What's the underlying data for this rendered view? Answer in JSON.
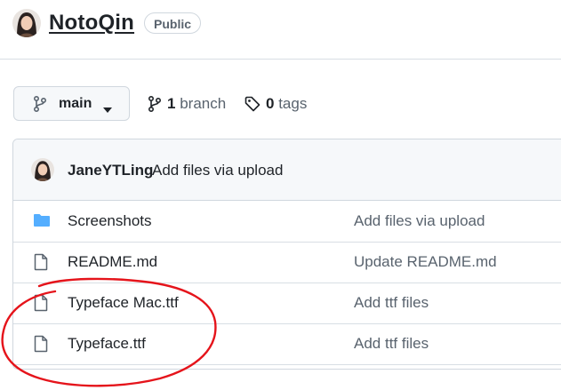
{
  "repo": {
    "owner_avatar": "user-avatar",
    "name": "NotoQin",
    "visibility": "Public"
  },
  "toolbar": {
    "branch_label": "main",
    "branch_count": "1",
    "branch_word": "branch",
    "tag_count": "0",
    "tag_word": "tags"
  },
  "latest_commit": {
    "author": "JaneYTLing",
    "message": "Add files via upload"
  },
  "files": [
    {
      "type": "folder",
      "name": "Screenshots",
      "commit": "Add files via upload"
    },
    {
      "type": "file",
      "name": "README.md",
      "commit": "Update README.md"
    },
    {
      "type": "file",
      "name": "Typeface Mac.ttf",
      "commit": "Add ttf files"
    },
    {
      "type": "file",
      "name": "Typeface.ttf",
      "commit": "Add ttf files"
    }
  ],
  "colors": {
    "folder": "#54aeff",
    "annotation": "#e5141b",
    "border": "#d0d7de"
  }
}
